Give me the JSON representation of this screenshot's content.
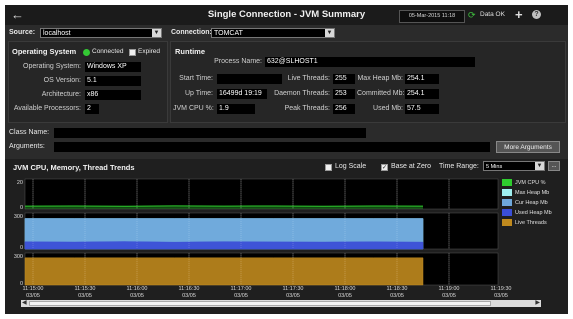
{
  "header": {
    "title": "Single Connection - JVM Summary",
    "datetime": "05-Mar-2015 11:18",
    "data_status": "Data OK"
  },
  "filters": {
    "source_label": "Source:",
    "source_value": "localhost",
    "connection_label": "Connection:",
    "connection_value": "TOMCAT"
  },
  "os_panel": {
    "title": "Operating System",
    "connected_label": "Connected",
    "expired_label": "Expired",
    "operating_system_label": "Operating System:",
    "operating_system_value": "Windows XP",
    "os_version_label": "OS Version:",
    "os_version_value": "5.1",
    "architecture_label": "Architecture:",
    "architecture_value": "x86",
    "processors_label": "Available Processors:",
    "processors_value": "2"
  },
  "runtime_panel": {
    "title": "Runtime",
    "process_name_label": "Process Name:",
    "process_name_value": "632@SLHOST1",
    "start_time_label": "Start Time:",
    "start_time_value": "",
    "up_time_label": "Up Time:",
    "up_time_value": "16499d 19:19",
    "cpu_label": "JVM CPU %:",
    "cpu_value": "1.9",
    "live_threads_label": "Live Threads:",
    "live_threads_value": "255",
    "daemon_threads_label": "Daemon Threads:",
    "daemon_threads_value": "253",
    "peak_threads_label": "Peak Threads:",
    "peak_threads_value": "256",
    "max_heap_label": "Max Heap Mb:",
    "max_heap_value": "254.1",
    "committed_label": "Committed Mb:",
    "committed_value": "254.1",
    "used_label": "Used Mb:",
    "used_value": "57.5"
  },
  "class_name_label": "Class Name:",
  "class_name_value": "",
  "arguments_label": "Arguments:",
  "arguments_value": "",
  "more_arguments_label": "More Arguments",
  "trends": {
    "title": "JVM CPU, Memory, Thread Trends",
    "log_scale_label": "Log Scale",
    "base_at_zero_label": "Base at Zero",
    "time_range_label": "Time Range:",
    "time_range_value": "5 Mins",
    "options_label": "..."
  },
  "chart_data": {
    "type": "area",
    "x": [
      "11:15:00 03/05",
      "11:15:30 03/05",
      "11:16:00 03/05",
      "11:16:30 03/05",
      "11:17:00 03/05",
      "11:17:30 03/05",
      "11:18:00 03/05",
      "11:18:30 03/05",
      "11:19:00 03/05",
      "11:19:30 03/05"
    ],
    "x_tick_times": [
      "11:15:00",
      "11:15:30",
      "11:16:00",
      "11:16:30",
      "11:17:00",
      "11:17:30",
      "11:18:00",
      "11:18:30",
      "11:19:00",
      "11:19:30"
    ],
    "x_tick_dates": [
      "03/05",
      "03/05",
      "03/05",
      "03/05",
      "03/05",
      "03/05",
      "03/05",
      "03/05",
      "03/05",
      "03/05"
    ],
    "panels": [
      {
        "ylim": [
          0,
          20
        ],
        "ticks": [
          "20",
          "0"
        ],
        "series": [
          {
            "name": "JVM CPU %",
            "color": "#2ecc2e",
            "values": [
              1.9,
              2.0,
              1.8,
              2.1,
              1.9,
              2.0,
              1.8,
              2.0,
              1.9
            ]
          }
        ]
      },
      {
        "ylim": [
          0,
          300
        ],
        "ticks": [
          "300",
          "0"
        ],
        "series": [
          {
            "name": "Max Heap Mb",
            "color": "#9ff0f0",
            "values": [
              254.1,
              254.1,
              254.1,
              254.1,
              254.1,
              254.1,
              254.1,
              254.1,
              254.1
            ]
          },
          {
            "name": "Cur Heap Mb",
            "color": "#6fa8dc",
            "values": [
              254.1,
              254.1,
              254.1,
              254.1,
              254.1,
              254.1,
              254.1,
              254.1,
              254.1
            ]
          },
          {
            "name": "Used Heap Mb",
            "color": "#3b4fd6",
            "values": [
              60,
              58,
              62,
              57,
              61,
              59,
              58,
              60,
              57.5
            ]
          }
        ]
      },
      {
        "ylim": [
          0,
          300
        ],
        "ticks": [
          "300",
          "0"
        ],
        "series": [
          {
            "name": "Live Threads",
            "color": "#c08a1e",
            "values": [
              255,
              255,
              255,
              255,
              255,
              255,
              255,
              255,
              255
            ]
          }
        ]
      }
    ],
    "legend_position": "right"
  }
}
